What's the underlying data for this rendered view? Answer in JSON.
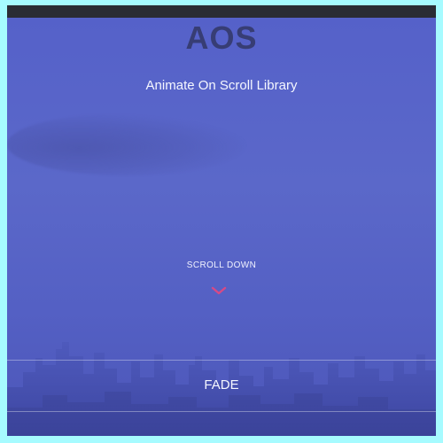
{
  "hero": {
    "title": "AOS",
    "subtitle": "Animate On Scroll Library",
    "scroll_hint": "SCROLL DOWN",
    "scroll_icon": "chevron-down-icon"
  },
  "section": {
    "label": "FADE"
  },
  "colors": {
    "overlay": "#5561c9",
    "title": "#373d74",
    "text": "#f5f7ff",
    "accent": "#d64a86",
    "frame": "#a6fbff",
    "topbar": "#2a2c34"
  }
}
